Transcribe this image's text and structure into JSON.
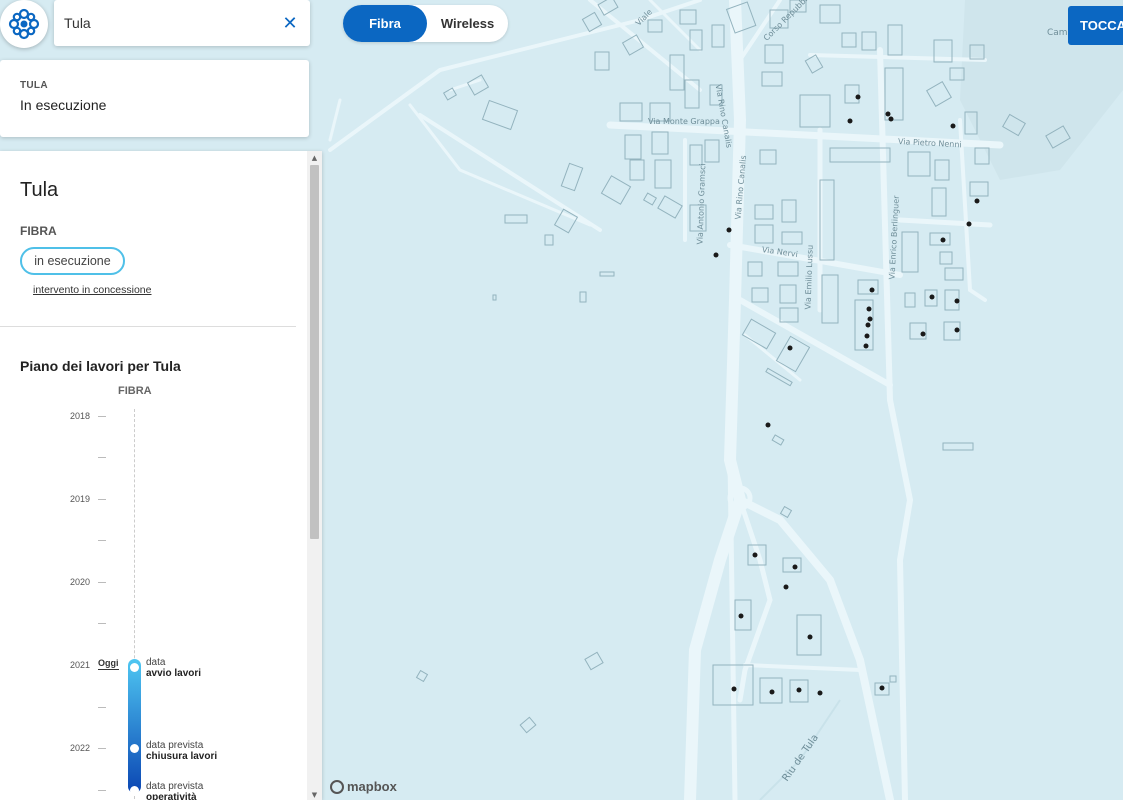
{
  "search": {
    "value": "Tula"
  },
  "summary": {
    "small_title": "TULA",
    "status": "In esecuzione"
  },
  "detail": {
    "title": "Tula",
    "technology": "FIBRA",
    "status_pill": "in esecuzione",
    "concession_link": "intervento in concessione"
  },
  "plan": {
    "title": "Piano dei lavori per Tula",
    "technology": "FIBRA",
    "years": [
      "2018",
      "2019",
      "2020",
      "2021",
      "2022"
    ],
    "today_label": "Oggi",
    "events": [
      {
        "line1": "data",
        "line2": "avvio lavori"
      },
      {
        "line1": "data prevista",
        "line2": "chiusura lavori"
      },
      {
        "line1": "data prevista",
        "line2": "operatività"
      }
    ]
  },
  "toggle": {
    "fibra": "Fibra",
    "wireless": "Wireless"
  },
  "tocca_button": "TOCCA",
  "map": {
    "attribution": "mapbox",
    "street_labels": [
      "Via Monte Grappa",
      "Via Antonio Gramsci",
      "Via Rino Canalis",
      "Via Rino Canalis",
      "Via Pietro Nenni",
      "Via Nervi",
      "Via Emilio Lussu",
      "Via Enrico Berlinguer",
      "Corso Repubblica",
      "Viale",
      "Riu de Tula",
      "Camp"
    ]
  },
  "colors": {
    "accent": "#0b67c2",
    "pill_border": "#4fc0e8",
    "map_water": "#d6ebf2",
    "road": "#eef8fb"
  }
}
